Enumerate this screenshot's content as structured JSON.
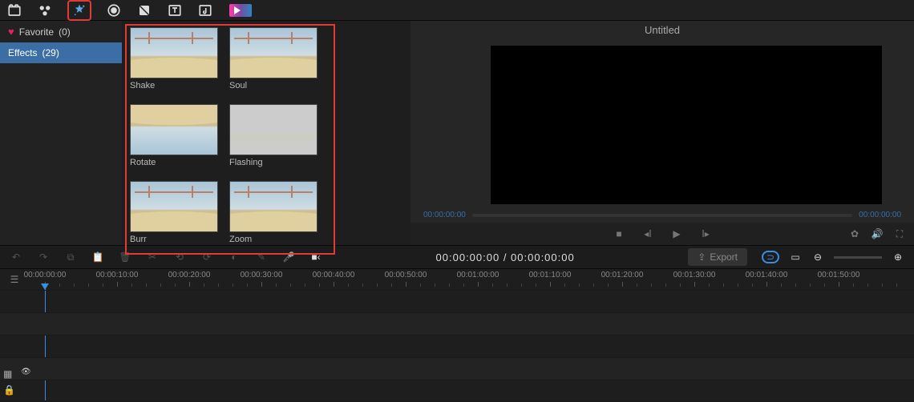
{
  "project_title": "Untitled",
  "toolbar": {
    "tools": [
      "media",
      "audio",
      "effects",
      "transitions",
      "filters",
      "text",
      "music",
      "export"
    ]
  },
  "sidebar": {
    "favorite": {
      "label": "Favorite",
      "count": "(0)"
    },
    "effects": {
      "label": "Effects",
      "count": "(29)"
    }
  },
  "effects": [
    {
      "label": "Shake"
    },
    {
      "label": "Soul"
    },
    {
      "label": "Rotate"
    },
    {
      "label": "Flashing"
    },
    {
      "label": "Burr"
    },
    {
      "label": "Zoom"
    }
  ],
  "preview": {
    "time_start": "00:00:00:00",
    "time_end": "00:00:00:00"
  },
  "timecode": "00:00:00:00 / 00:00:00:00",
  "export_label": "Export",
  "ruler": [
    "00:00:00:00",
    "00:00:10:00",
    "00:00:20:00",
    "00:00:30:00",
    "00:00:40:00",
    "00:00:50:00",
    "00:01:00:00",
    "00:01:10:00",
    "00:01:20:00",
    "00:01:30:00",
    "00:01:40:00",
    "00:01:50:00"
  ]
}
